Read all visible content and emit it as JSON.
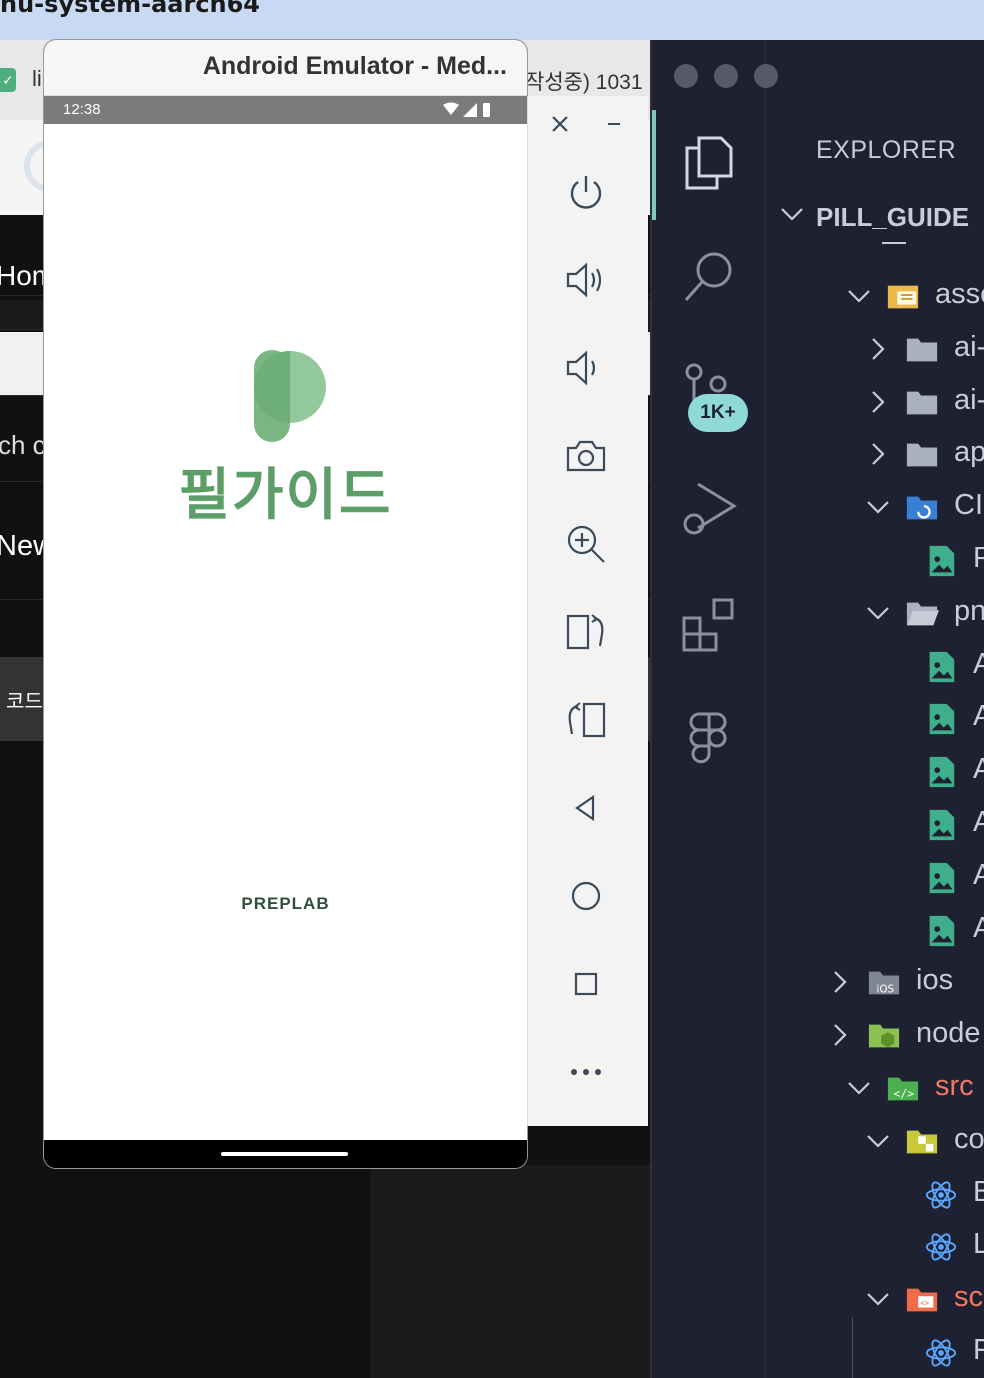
{
  "top_strip": {
    "title": "nu-system-aarch64"
  },
  "browser": {
    "tab_text": "li",
    "tab_right_text": "작성중) 1031",
    "nav_items": [
      "Hom",
      "ch c",
      "New"
    ],
    "code_label": "코드"
  },
  "emulator": {
    "window_title": "Android Emulator - Med...",
    "status_time": "12:38",
    "app_name": "필가이드",
    "footer_brand": "PREPLAB",
    "brand_color": "#5b9e67",
    "toolbar": [
      "close-icon",
      "minimize-icon",
      "power-icon",
      "volume-up-icon",
      "volume-down-icon",
      "camera-icon",
      "zoom-in-icon",
      "rotate-left-icon",
      "rotate-right-icon",
      "back-icon",
      "home-icon",
      "overview-icon",
      "more-icon"
    ]
  },
  "vscode": {
    "badge": "1K+",
    "explorer_title": "EXPLORER",
    "project": "PILL_GUIDE",
    "tree": [
      {
        "label": "asse",
        "kind": "folder-assets",
        "open": true
      },
      {
        "label": "ai-(",
        "kind": "folder",
        "open": false
      },
      {
        "label": "ai-(",
        "kind": "folder",
        "open": false
      },
      {
        "label": "app",
        "kind": "folder",
        "open": false
      },
      {
        "label": "CI",
        "kind": "folder-ci",
        "open": true
      },
      {
        "label": "Pr",
        "kind": "image-file"
      },
      {
        "label": "png",
        "kind": "folder-open",
        "open": true
      },
      {
        "label": "As",
        "kind": "image-file"
      },
      {
        "label": "As",
        "kind": "image-file"
      },
      {
        "label": "As",
        "kind": "image-file"
      },
      {
        "label": "As",
        "kind": "image-file"
      },
      {
        "label": "As",
        "kind": "image-file"
      },
      {
        "label": "As",
        "kind": "image-file"
      },
      {
        "label": "ios",
        "kind": "folder-ios",
        "open": false
      },
      {
        "label": "node",
        "kind": "folder-node",
        "open": false
      },
      {
        "label": "src",
        "kind": "folder-src",
        "open": true
      },
      {
        "label": "con",
        "kind": "folder-components",
        "open": true
      },
      {
        "label": "Bu",
        "kind": "react-file"
      },
      {
        "label": "Lo",
        "kind": "react-file"
      },
      {
        "label": "scr",
        "kind": "folder-screens",
        "open": true
      },
      {
        "label": "Fi",
        "kind": "react-file"
      }
    ]
  }
}
